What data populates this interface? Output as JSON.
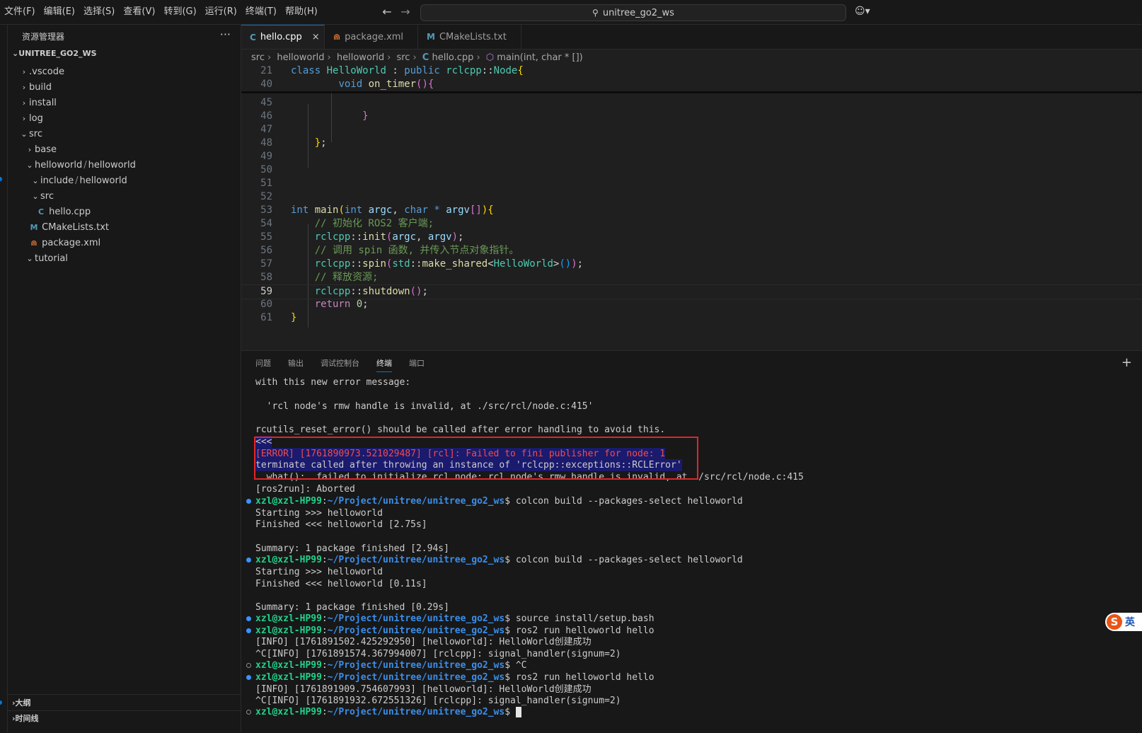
{
  "menu": [
    "文件(F)",
    "编辑(E)",
    "选择(S)",
    "查看(V)",
    "转到(G)",
    "运行(R)",
    "终端(T)",
    "帮助(H)"
  ],
  "command_center": "unitree_go2_ws",
  "sidebar": {
    "header": "资源管理器",
    "more": "···",
    "root": "UNITREE_GO2_WS",
    "items": [
      {
        "label": ".vscode"
      },
      {
        "label": "build"
      },
      {
        "label": "install"
      },
      {
        "label": "log"
      },
      {
        "label": "src"
      },
      {
        "label": "base"
      },
      {
        "label": "helloworld",
        "label2": "helloworld"
      },
      {
        "label": "include",
        "label2": "helloworld"
      },
      {
        "label": "src"
      },
      {
        "label": "hello.cpp",
        "icon": "C"
      },
      {
        "label": "CMakeLists.txt",
        "icon": "M"
      },
      {
        "label": "package.xml",
        "icon": "⋒"
      },
      {
        "label": "tutorial"
      }
    ],
    "outline": "大纲",
    "timeline": "时间线"
  },
  "tabs": [
    {
      "label": "hello.cpp",
      "icon": "C",
      "close": "×"
    },
    {
      "label": "package.xml",
      "icon": "⋒"
    },
    {
      "label": "CMakeLists.txt",
      "icon": "M"
    }
  ],
  "breadcrumb": [
    "src",
    "helloworld",
    "helloworld",
    "src",
    "hello.cpp",
    "main(int, char * [])"
  ],
  "code_lines": [
    {
      "n": "21",
      "text": "class HelloWorld : public rclcpp::Node{"
    },
    {
      "n": "40",
      "text": "        void on_timer(){"
    },
    {
      "n": "45",
      "text": ""
    },
    {
      "n": "46",
      "text": "            }"
    },
    {
      "n": "47",
      "text": ""
    },
    {
      "n": "48",
      "text": "    };"
    },
    {
      "n": "49",
      "text": ""
    },
    {
      "n": "50",
      "text": ""
    },
    {
      "n": "51",
      "text": ""
    },
    {
      "n": "52",
      "text": ""
    },
    {
      "n": "53",
      "text": "int main(int argc, char * argv[]){"
    },
    {
      "n": "54",
      "text": "    // 初始化 ROS2 客户端;"
    },
    {
      "n": "55",
      "text": "    rclcpp::init(argc, argv);"
    },
    {
      "n": "56",
      "text": "    // 调用 spin 函数, 并传入节点对象指针。"
    },
    {
      "n": "57",
      "text": "    rclcpp::spin(std::make_shared<HelloWorld>());"
    },
    {
      "n": "58",
      "text": "    // 释放资源;"
    },
    {
      "n": "59",
      "text": "    rclcpp::shutdown();"
    },
    {
      "n": "60",
      "text": "    return 0;"
    },
    {
      "n": "61",
      "text": "}"
    }
  ],
  "panel_tabs": [
    "问题",
    "输出",
    "调试控制台",
    "终端",
    "端口"
  ],
  "panel_add": "+",
  "terminal": {
    "user": "xzl@xzl-HP99",
    "path": "~/Project/unitree/unitree_go2_ws",
    "lines": [
      "with this new error message:",
      "",
      "  'rcl node's rmw handle is invalid, at ./src/rcl/node.c:415'",
      "",
      "rcutils_reset_error() should be called after error handling to avoid this.",
      "<<<",
      "[ERROR] [1761890973.521029487] [rcl]: Failed to fini publisher for node: 1",
      "terminate called after throwing an instance of 'rclcpp::exceptions::RCLError'",
      "  what():  failed to initialize rcl node: rcl node's rmw handle is invalid, at ./src/rcl/node.c:415",
      "[ros2run]: Aborted",
      "$ colcon build --packages-select helloworld",
      "Starting >>> helloworld",
      "Finished <<< helloworld [2.75s]",
      "",
      "Summary: 1 package finished [2.94s]",
      "$ colcon build --packages-select helloworld",
      "Starting >>> helloworld",
      "Finished <<< helloworld [0.11s]",
      "",
      "Summary: 1 package finished [0.29s]",
      "$ source install/setup.bash",
      "$ ros2 run helloworld hello",
      "[INFO] [1761891502.425292950] [helloworld]: HelloWorld创建成功",
      "^C[INFO] [1761891574.367994007] [rclcpp]: signal_handler(signum=2)",
      "$ ^C",
      "$ ros2 run helloworld hello",
      "[INFO] [1761891909.754607993] [helloworld]: HelloWorld创建成功",
      "^C[INFO] [1761891932.672551326] [rclcpp]: signal_handler(signum=2)",
      "$ "
    ]
  },
  "ime": {
    "s": "S",
    "label": "英"
  },
  "colors": {
    "accent": "#0078d4",
    "prompt_user": "#23d18b",
    "prompt_path": "#3b8eea",
    "highlight_box": "#e0262b"
  }
}
